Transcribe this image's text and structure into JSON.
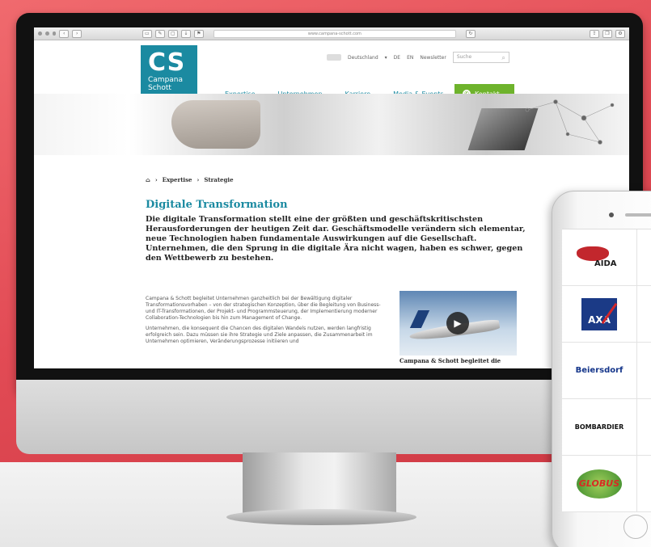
{
  "browser": {
    "url": "www.campana-schott.com"
  },
  "site": {
    "logo": {
      "initials": "CS",
      "name_line1": "Campana",
      "name_line2": "Schott"
    },
    "topbar": {
      "country": "Deutschland",
      "lang_de": "DE",
      "lang_en": "EN",
      "newsletter": "Newsletter",
      "search_placeholder": "Suche"
    },
    "nav": [
      "Expertise",
      "Unternehmen",
      "Karriere",
      "Media & Events"
    ],
    "contact_label": "Kontakt"
  },
  "breadcrumb": [
    "Expertise",
    "Strategie"
  ],
  "article": {
    "title": "Digitale Transformation",
    "lead": "Die digitale Transformation stellt eine der größten und geschäftskritischsten Herausforderungen der heutigen Zeit dar. Geschäftsmodelle verändern sich elementar, neue Technologien haben fundamentale Auswirkungen auf die Gesellschaft. Unternehmen, die den Sprung in die digitale Ära nicht wagen, haben es schwer, gegen den Wettbewerb zu bestehen.",
    "para1": "Campana & Schott begleitet Unternehmen ganzheitlich bei der Bewältigung digitaler Transformationsvorhaben – von der strategischen Konzeption, über die Begleitung von Business- und IT-Transformationen, der Projekt- und Programmsteuerung, der Implementierung moderner Collaboration-Technologien bis hin zum Management of Change.",
    "para2": "Unternehmen, die konsequent die Chancen des digitalen Wandels nutzen, werden langfristig erfolgreich sein. Dazu müssen sie ihre Strategie und Ziele anpassen, die Zusammenarbeit im Unternehmen optimieren, Veränderungsprozesse initiieren und",
    "video_caption": "Campana & Schott begleitet die"
  },
  "phone": {
    "logos": [
      "AIDA",
      "AXA",
      "Beiersdorf",
      "BOMBARDIER",
      "GLOBUS"
    ]
  },
  "colors": {
    "teal": "#1b8aa1",
    "green": "#6eb32c",
    "background": "#e24b55"
  }
}
